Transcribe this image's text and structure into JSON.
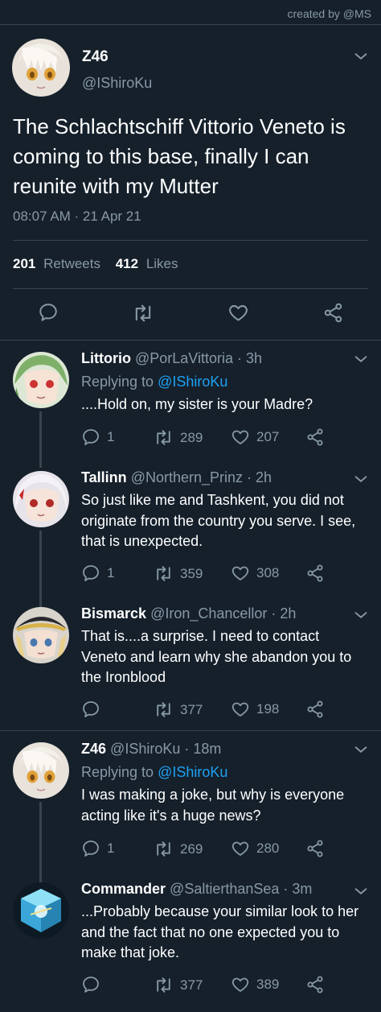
{
  "credit": "created by @MS",
  "main_tweet": {
    "name": "Z46",
    "handle": "@IShiroKu",
    "text": "The Schlachtschiff Vittorio Veneto is coming to this base, finally I can reunite with my Mutter",
    "time": "08:07 AM · 21 Apr 21",
    "retweets_count": "201",
    "retweets_label": "Retweets",
    "likes_count": "412",
    "likes_label": "Likes"
  },
  "replies": [
    {
      "name": "Littorio",
      "handle": "@PorLaVittoria · 3h",
      "replying_prefix": "Replying to",
      "replying_to": "@IShiroKu",
      "text": "....Hold on, my sister is your Madre?",
      "replies": "1",
      "retweets": "289",
      "likes": "207"
    },
    {
      "name": "Tallinn",
      "handle": "@Northern_Prinz · 2h",
      "text": "So just like me and Tashkent, you did not originate from the country you serve. I see, that is unexpected.",
      "replies": "1",
      "retweets": "359",
      "likes": "308"
    },
    {
      "name": "Bismarck",
      "handle": "@Iron_Chancellor · 2h",
      "text": "That is....a surprise. I need to contact Veneto and learn why she abandon you to the Ironblood",
      "replies": "",
      "retweets": "377",
      "likes": "198"
    },
    {
      "name": "Z46",
      "handle": "@IShiroKu · 18m",
      "replying_prefix": "Replying to",
      "replying_to": "@IShiroKu",
      "text": "I was making a joke, but why is everyone acting like it's a huge news?",
      "replies": "1",
      "retweets": "269",
      "likes": "280"
    },
    {
      "name": "Commander",
      "handle": "@SaltierthanSea · 3m",
      "text": "...Probably because your similar look to her and the fact that no one expected you to make that joke.",
      "replies": "",
      "retweets": "377",
      "likes": "389"
    }
  ],
  "icons": {
    "reply": "speech-bubble-icon",
    "retweet": "retweet-arrows-icon",
    "like": "heart-icon",
    "share": "share-nodes-icon",
    "more": "chevron-down-icon"
  },
  "colors": {
    "background": "#15202b",
    "muted": "#8899a6",
    "mention": "#1da1f2",
    "divider": "#38444d"
  }
}
